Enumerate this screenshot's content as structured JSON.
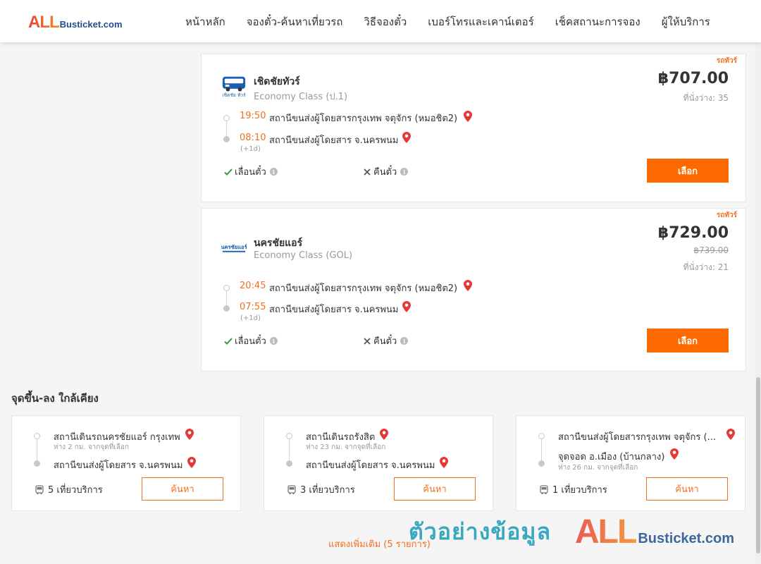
{
  "brand": {
    "logo_all": "ALL",
    "logo_rest": "Busticket.com"
  },
  "nav": [
    {
      "label": "หน้าหลัก"
    },
    {
      "label": "จองตั๋ว-ค้นหาเที่ยวรถ"
    },
    {
      "label": "วิธีจองตั๋ว"
    },
    {
      "label": "เบอร์โทรและเคาน์เตอร์"
    },
    {
      "label": "เช็คสถานะการจอง"
    },
    {
      "label": "ผู้ให้บริการ"
    }
  ],
  "trips": [
    {
      "tag": "รถทัวร์",
      "operator": "เชิดชัยทัวร์",
      "bus_class": "Economy Class (ป.1)",
      "logo_text": "เชิดชัย ทัวร์",
      "price": "฿707.00",
      "original_price": "",
      "seats": "ที่นั่งว่าง: 35",
      "depart_time": "19:50",
      "depart_stop": "สถานีขนส่งผู้โดยสารกรุงเทพ จตุจักร (หมอชิต2)",
      "arrive_time": "08:10",
      "arrive_stop": "สถานีขนส่งผู้โดยสาร จ.นครพนม",
      "next_day": "(+1d)",
      "reschedule": "เลื่อนตั๋ว",
      "refund": "คืนตั๋ว",
      "select": "เลือก"
    },
    {
      "tag": "รถทัวร์",
      "operator": "นครชัยแอร์",
      "bus_class": "Economy Class (GOL)",
      "logo_text": "นครชัยแอร์",
      "price": "฿729.00",
      "original_price": "฿739.00",
      "seats": "ที่นั่งว่าง: 21",
      "depart_time": "20:45",
      "depart_stop": "สถานีขนส่งผู้โดยสารกรุงเทพ จตุจักร (หมอชิต2)",
      "arrive_time": "07:55",
      "arrive_stop": "สถานีขนส่งผู้โดยสาร จ.นครพนม",
      "next_day": "(+1d)",
      "reschedule": "เลื่อนตั๋ว",
      "refund": "คืนตั๋ว",
      "select": "เลือก"
    }
  ],
  "nearby": {
    "title": "จุดขึ้น-ลง ใกล้เคียง",
    "items": [
      {
        "from": "สถานีเดินรถนครชัยแอร์ กรุงเทพ",
        "from_dist": "ห่าง 2 กม. จากจุดที่เลือก",
        "to": "สถานีขนส่งผู้โดยสาร จ.นครพนม",
        "to_dist": "",
        "count": "5 เที่ยวบริการ",
        "search": "ค้นหา"
      },
      {
        "from": "สถานีเดินรถรังสิต",
        "from_dist": "ห่าง 23 กม. จากจุดที่เลือก",
        "to": "สถานีขนส่งผู้โดยสาร จ.นครพนม",
        "to_dist": "",
        "count": "3 เที่ยวบริการ",
        "search": "ค้นหา"
      },
      {
        "from": "สถานีขนส่งผู้โดยสารกรุงเทพ จตุจักร (...",
        "from_dist": "",
        "to": "จุดจอด อ.เมือง (บ้านกลาง)",
        "to_dist": "ห่าง 26 กม. จากจุดที่เลือก",
        "count": "1 เที่ยวบริการ",
        "search": "ค้นหา"
      }
    ],
    "show_more": "แสดงเพิ่มเติม (5 รายการ)"
  },
  "watermark": {
    "text": "ตัวอย่างข้อมูล",
    "logo_all": "ALL",
    "logo_rest": "Busticket.com"
  },
  "colors": {
    "accent": "#ff6a00",
    "text_orange": "#f36f21",
    "pin": "#e53935",
    "check": "#2e9e3a",
    "brand_blue": "#1f4e8c",
    "watermark": "#1a9bb5"
  },
  "icons": {
    "pin": "map-pin-icon",
    "check": "check-icon",
    "cross": "cross-icon",
    "info": "info-icon",
    "bus": "bus-icon"
  }
}
